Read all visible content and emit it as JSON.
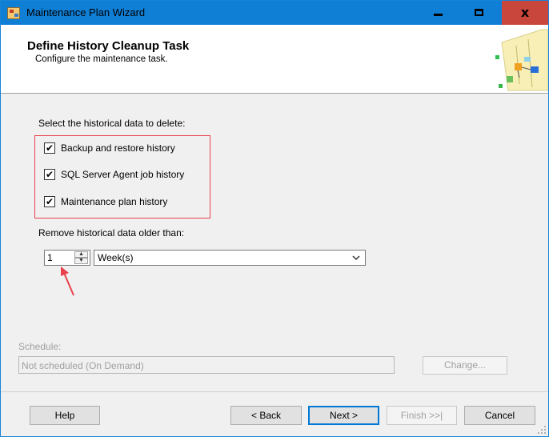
{
  "window": {
    "title": "Maintenance Plan Wizard",
    "close_glyph": "x"
  },
  "header": {
    "title": "Define History Cleanup Task",
    "subtitle": "Configure the maintenance task."
  },
  "content": {
    "select_label": "Select the historical data to delete:",
    "options": [
      {
        "label": "Backup and restore history",
        "checked": true,
        "mark": "✔"
      },
      {
        "label": "SQL Server Agent job history",
        "checked": true,
        "mark": "✔"
      },
      {
        "label": "Maintenance plan history",
        "checked": true,
        "mark": "✔"
      }
    ],
    "remove_label": "Remove historical data older than:",
    "age_value": "1",
    "age_unit": "Week(s)",
    "highlight_color": "#e8414b"
  },
  "schedule": {
    "label": "Schedule:",
    "value": "Not scheduled (On Demand)",
    "change_button": "Change..."
  },
  "footer": {
    "help": "Help",
    "back": "< Back",
    "next": "Next >",
    "finish": "Finish >>|",
    "cancel": "Cancel"
  },
  "colors": {
    "titlebar": "#0f7fd6",
    "close_button": "#c9463d",
    "default_button_border": "#0078d7"
  }
}
